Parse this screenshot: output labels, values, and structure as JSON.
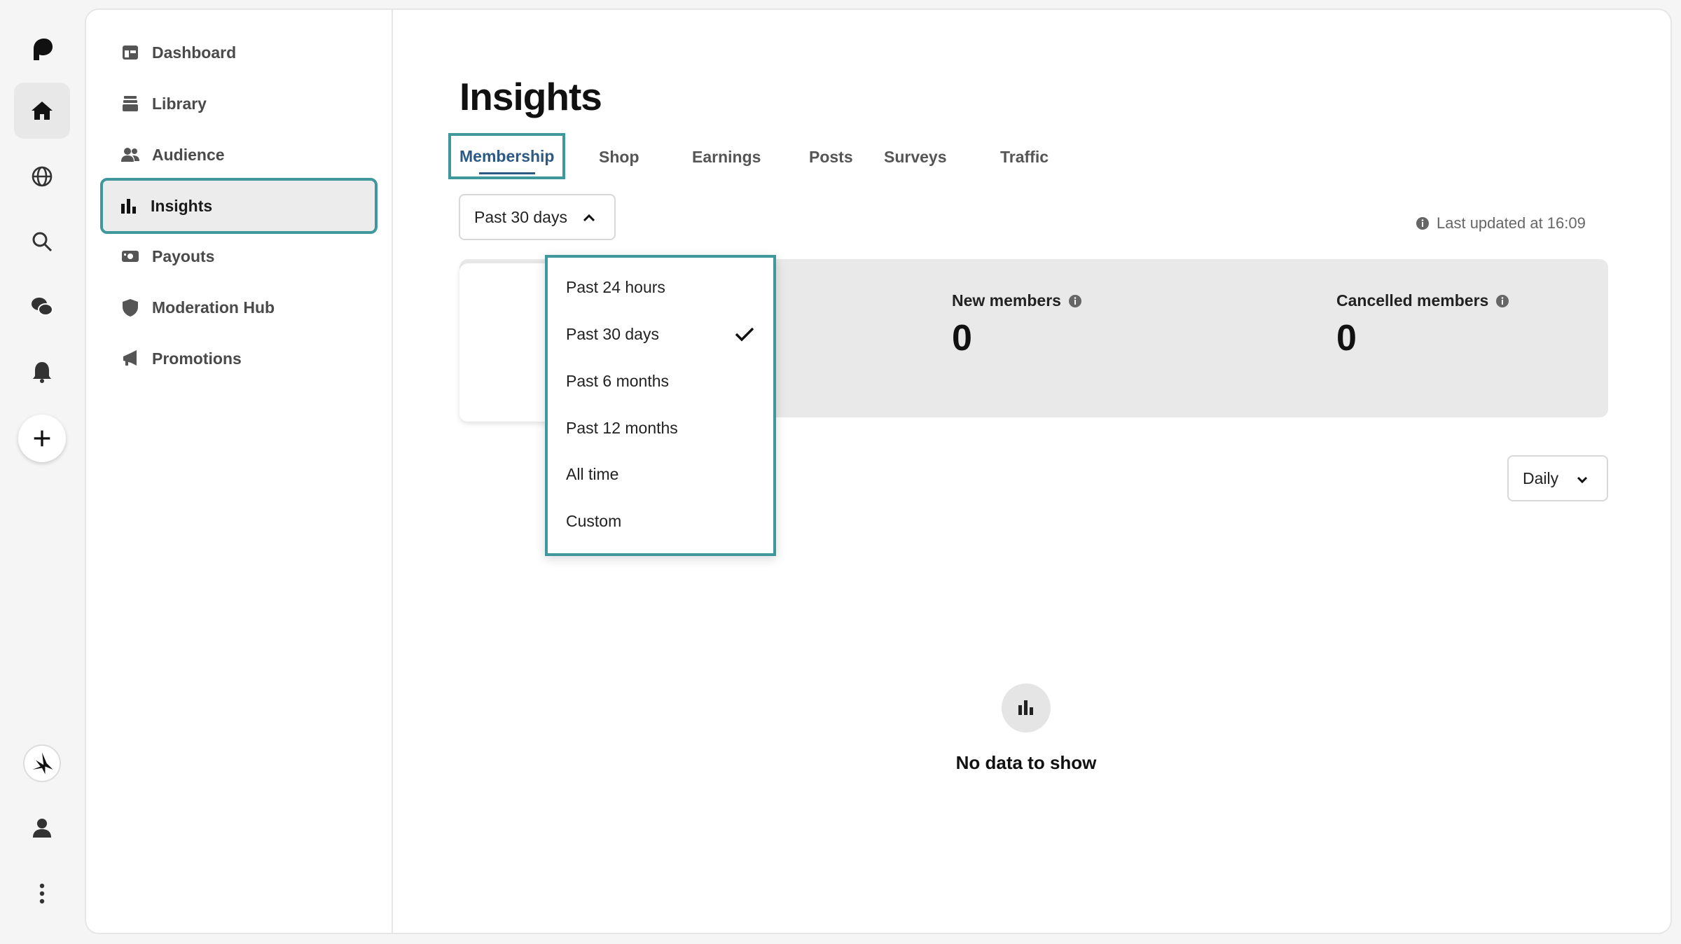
{
  "rail": {
    "icons": [
      "patreon-logo-icon",
      "home-icon",
      "globe-icon",
      "search-icon",
      "chat-icon",
      "bell-icon",
      "plus-icon",
      "avatar",
      "user-icon",
      "more-icon"
    ]
  },
  "sidebar": {
    "items": [
      {
        "label": "Dashboard",
        "icon": "dashboard-icon"
      },
      {
        "label": "Library",
        "icon": "library-icon"
      },
      {
        "label": "Audience",
        "icon": "audience-icon"
      },
      {
        "label": "Insights",
        "icon": "insights-icon",
        "active": true
      },
      {
        "label": "Payouts",
        "icon": "payouts-icon"
      },
      {
        "label": "Moderation Hub",
        "icon": "shield-icon"
      },
      {
        "label": "Promotions",
        "icon": "megaphone-icon"
      }
    ]
  },
  "main": {
    "title": "Insights",
    "tabs": [
      {
        "label": "Membership",
        "active": true
      },
      {
        "label": "Shop"
      },
      {
        "label": "Earnings"
      },
      {
        "label": "Posts"
      },
      {
        "label": "Surveys"
      },
      {
        "label": "Traffic"
      }
    ],
    "range_select": {
      "value": "Past 30 days"
    },
    "last_updated": "Last updated at 16:09",
    "stats": [
      {
        "label": "New members",
        "value": "0"
      },
      {
        "label": "Cancelled members",
        "value": "0"
      }
    ],
    "interval_select": {
      "value": "Daily"
    },
    "empty_state": "No data to show"
  },
  "range_menu": {
    "options": [
      "Past 24 hours",
      "Past 30 days",
      "Past 6 months",
      "Past 12 months",
      "All time",
      "Custom"
    ],
    "selected": "Past 30 days"
  },
  "colors": {
    "highlight": "#3f989c",
    "active_tab": "#2c5a85"
  }
}
